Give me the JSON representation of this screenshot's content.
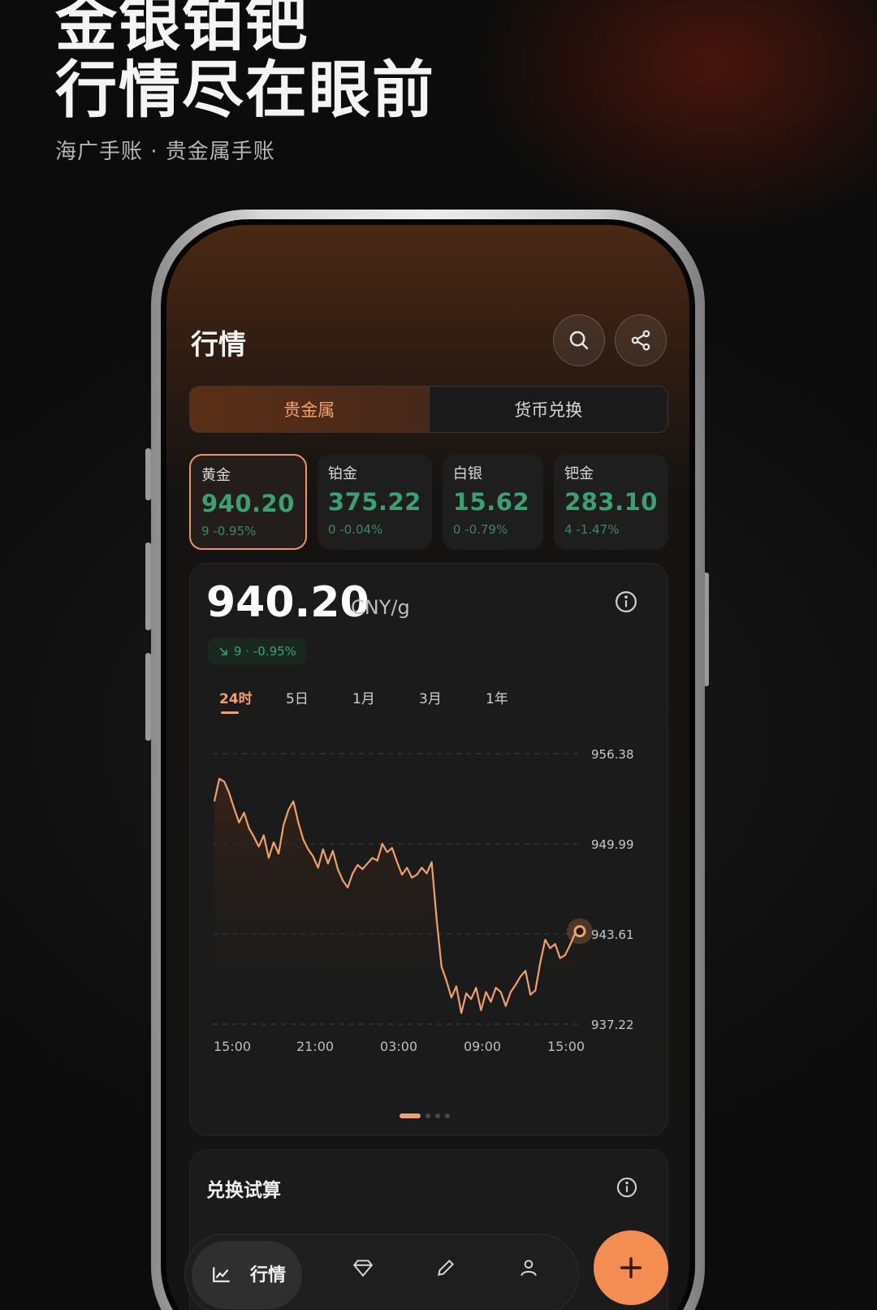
{
  "promo": {
    "headline_line1": "金银铂钯",
    "headline_line2": "行情尽在眼前",
    "subtitle": "海广手账 · 贵金属手账"
  },
  "header": {
    "title": "行情"
  },
  "segments": [
    {
      "label": "贵金属",
      "active": true
    },
    {
      "label": "货币兑换",
      "active": false
    }
  ],
  "metals": [
    {
      "name": "黄金",
      "price": "940.20",
      "change": "9 -0.95%",
      "active": true
    },
    {
      "name": "铂金",
      "price": "375.22",
      "change": "0 -0.04%",
      "active": false
    },
    {
      "name": "白银",
      "price": "15.62",
      "change": "0 -0.79%",
      "active": false
    },
    {
      "name": "钯金",
      "price": "283.10",
      "change": "4 -1.47%",
      "active": false
    }
  ],
  "detail": {
    "price": "940.20",
    "unit": "CNY/g",
    "change_badge": "9 · -0.95%"
  },
  "ranges": [
    {
      "label": "24时",
      "active": true
    },
    {
      "label": "5日",
      "active": false
    },
    {
      "label": "1月",
      "active": false
    },
    {
      "label": "3月",
      "active": false
    },
    {
      "label": "1年",
      "active": false
    }
  ],
  "chart_data": {
    "type": "area",
    "y_ticks": [
      "956.38",
      "949.99",
      "943.61",
      "937.22"
    ],
    "ylim": [
      937.22,
      956.38
    ],
    "x_ticks": [
      "15:00",
      "21:00",
      "03:00",
      "09:00",
      "15:00"
    ],
    "grid": "horizontal dashed",
    "line_color": "#f0a06b",
    "values": [
      953.0,
      954.6,
      954.4,
      953.6,
      952.5,
      951.5,
      952.2,
      951.1,
      950.5,
      949.8,
      950.6,
      949.0,
      950.1,
      949.3,
      951.3,
      952.4,
      953.0,
      951.5,
      950.3,
      949.6,
      949.1,
      948.3,
      949.6,
      948.6,
      949.5,
      948.2,
      947.4,
      946.9,
      947.9,
      948.5,
      948.2,
      948.6,
      949.0,
      948.8,
      950.0,
      949.4,
      949.7,
      948.7,
      947.8,
      948.3,
      947.6,
      947.8,
      948.3,
      947.9,
      948.7,
      944.7,
      941.3,
      940.3,
      939.1,
      939.9,
      938.0,
      939.4,
      939.0,
      939.8,
      938.2,
      939.5,
      938.8,
      939.8,
      939.5,
      938.5,
      939.5,
      940.0,
      940.6,
      941.0,
      939.3,
      939.6,
      941.6,
      943.2,
      942.6,
      942.9,
      941.9,
      942.1,
      942.8,
      943.6,
      943.8
    ],
    "current_value": 943.6
  },
  "pager": {
    "count": 4,
    "active_index": 0
  },
  "convert": {
    "title": "兑换试算"
  },
  "nav": {
    "active_label": "行情",
    "icons": [
      "chart-icon",
      "diamond-icon",
      "pen-icon",
      "user-icon"
    ]
  },
  "fab": {
    "icon": "plus-icon"
  },
  "colors": {
    "accent": "#f0a06b",
    "positive_green": "#3d9f74",
    "fab": "#f38d52"
  }
}
